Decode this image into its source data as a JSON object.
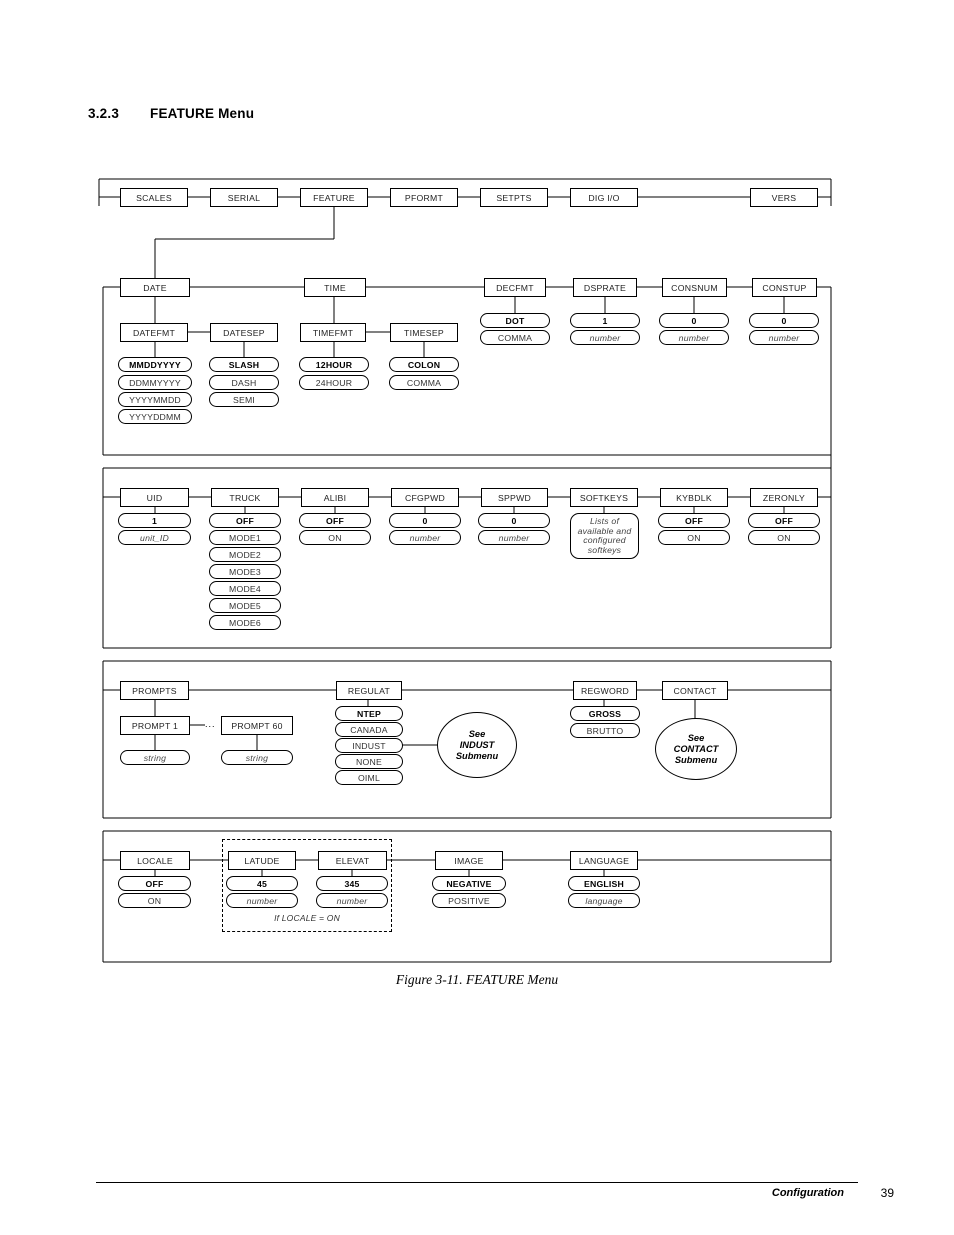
{
  "section": {
    "number": "3.2.3",
    "title": "FEATURE Menu"
  },
  "caption": "Figure 3-11. FEATURE Menu",
  "footer": {
    "chapter": "Configuration",
    "page": "39"
  },
  "top_row": {
    "items": [
      {
        "label": "SCALES"
      },
      {
        "label": "SERIAL"
      },
      {
        "label": "FEATURE"
      },
      {
        "label": "PFORMT"
      },
      {
        "label": "SETPTS"
      },
      {
        "label": "DIG I/O"
      },
      {
        "label": "VERS"
      }
    ]
  },
  "band1": {
    "groups": [
      {
        "label": "DATE",
        "children": [
          {
            "label": "DATEFMT",
            "options": [
              "MMDDYYYY",
              "DDMMYYYY",
              "YYYYMMDD",
              "YYYYDDMM"
            ],
            "default": "MMDDYYYY"
          },
          {
            "label": "DATESEP",
            "options": [
              "SLASH",
              "DASH",
              "SEMI"
            ],
            "default": "SLASH"
          }
        ]
      },
      {
        "label": "TIME",
        "children": [
          {
            "label": "TIMEFMT",
            "options": [
              "12HOUR",
              "24HOUR"
            ],
            "default": "12HOUR"
          },
          {
            "label": "TIMESEP",
            "options": [
              "COLON",
              "COMMA"
            ],
            "default": "COLON"
          }
        ]
      },
      {
        "label": "DECFMT",
        "options": [
          "DOT",
          "COMMA"
        ],
        "default": "DOT"
      },
      {
        "label": "DSPRATE",
        "options": [
          "1",
          "number"
        ],
        "default": "1",
        "italic": [
          "number"
        ]
      },
      {
        "label": "CONSNUM",
        "options": [
          "0",
          "number"
        ],
        "default": "0",
        "italic": [
          "number"
        ]
      },
      {
        "label": "CONSTUP",
        "options": [
          "0",
          "number"
        ],
        "default": "0",
        "italic": [
          "number"
        ]
      }
    ]
  },
  "band2": {
    "groups": [
      {
        "label": "UID",
        "options": [
          "1",
          "unit_ID"
        ],
        "default": "1",
        "italic": [
          "unit_ID"
        ]
      },
      {
        "label": "TRUCK",
        "options": [
          "OFF",
          "MODE1",
          "MODE2",
          "MODE3",
          "MODE4",
          "MODE5",
          "MODE6"
        ],
        "default": "OFF"
      },
      {
        "label": "ALIBI",
        "options": [
          "OFF",
          "ON"
        ],
        "default": "OFF"
      },
      {
        "label": "CFGPWD",
        "options": [
          "0",
          "number"
        ],
        "default": "0",
        "italic": [
          "number"
        ]
      },
      {
        "label": "SPPWD",
        "options": [
          "0",
          "number"
        ],
        "default": "0",
        "italic": [
          "number"
        ]
      },
      {
        "label": "SOFTKEYS",
        "note": "Lists of available and configured softkeys"
      },
      {
        "label": "KYBDLK",
        "options": [
          "OFF",
          "ON"
        ],
        "default": "OFF"
      },
      {
        "label": "ZERONLY",
        "options": [
          "OFF",
          "ON"
        ],
        "default": "OFF"
      }
    ]
  },
  "band3": {
    "prompts": {
      "label": "PROMPTS",
      "first": {
        "label": "PROMPT 1",
        "option": "string"
      },
      "last": {
        "label": "PROMPT 60",
        "option": "string"
      },
      "ellipsis": "..."
    },
    "regulat": {
      "label": "REGULAT",
      "options": [
        "NTEP",
        "CANADA",
        "INDUST",
        "NONE",
        "OIML"
      ],
      "default": "NTEP"
    },
    "indust_ref": {
      "line1": "See",
      "line2": "INDUST",
      "line3": "Submenu"
    },
    "regword": {
      "label": "REGWORD",
      "options": [
        "GROSS",
        "BRUTTO"
      ],
      "default": "GROSS"
    },
    "contact": {
      "label": "CONTACT"
    },
    "contact_ref": {
      "line1": "See",
      "line2": "CONTACT",
      "line3": "Submenu"
    }
  },
  "band4": {
    "locale": {
      "label": "LOCALE",
      "options": [
        "OFF",
        "ON"
      ],
      "default": "OFF"
    },
    "latude": {
      "label": "LATUDE",
      "options": [
        "45",
        "number"
      ],
      "default": "45",
      "italic": [
        "number"
      ]
    },
    "elevat": {
      "label": "ELEVAT",
      "options": [
        "345",
        "number"
      ],
      "default": "345",
      "italic": [
        "number"
      ]
    },
    "condition": "If LOCALE = ON",
    "image": {
      "label": "IMAGE",
      "options": [
        "NEGATIVE",
        "POSITIVE"
      ],
      "default": "NEGATIVE"
    },
    "language": {
      "label": "LANGUAGE",
      "options": [
        "ENGLISH",
        "language"
      ],
      "default": "ENGLISH",
      "italic": [
        "language"
      ]
    }
  }
}
